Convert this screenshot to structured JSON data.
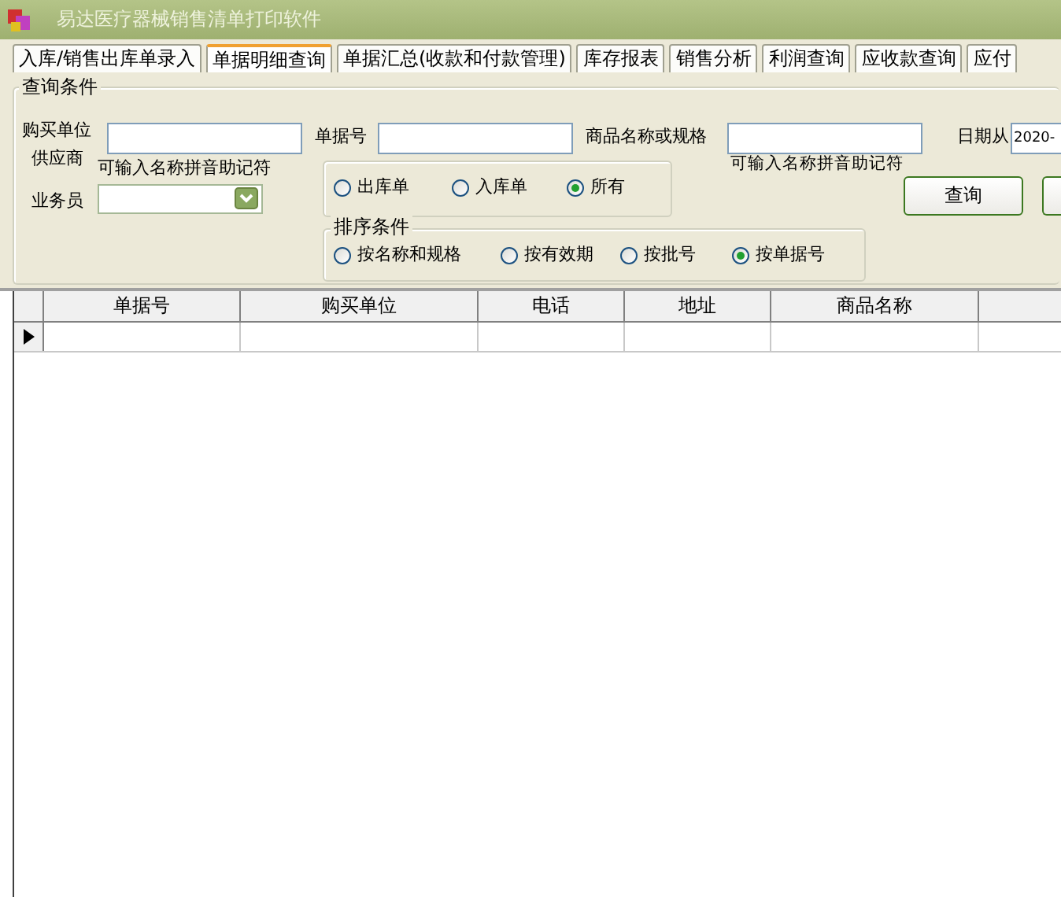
{
  "window": {
    "title": "易达医疗器械销售清单打印软件"
  },
  "tabs": [
    {
      "label": "入库/销售出库单录入",
      "selected": false
    },
    {
      "label": "单据明细查询",
      "selected": true
    },
    {
      "label": "单据汇总(收款和付款管理)",
      "selected": false
    },
    {
      "label": "库存报表",
      "selected": false
    },
    {
      "label": "销售分析",
      "selected": false
    },
    {
      "label": "利润查询",
      "selected": false
    },
    {
      "label": "应收款查询",
      "selected": false
    },
    {
      "label": "应付",
      "selected": false
    }
  ],
  "query": {
    "title": "查询条件",
    "buyer_label": "购买单位",
    "supplier_label": "供应商",
    "buyer_hint": "可输入名称拼音助记符",
    "salesperson_label": "业务员",
    "doc_no_label": "单据号",
    "product_label": "商品名称或规格",
    "product_hint": "可输入名称拼音助记符",
    "date_label": "日期从",
    "date_value": "2020-",
    "doc_types": [
      {
        "label": "出库单",
        "selected": false
      },
      {
        "label": "入库单",
        "selected": false
      },
      {
        "label": "所有",
        "selected": true
      }
    ],
    "sort_title": "排序条件",
    "sort_options": [
      {
        "label": "按名称和规格",
        "selected": false
      },
      {
        "label": "按有效期",
        "selected": false
      },
      {
        "label": "按批号",
        "selected": false
      },
      {
        "label": "按单据号",
        "selected": true
      }
    ],
    "search_button": "查询"
  },
  "table": {
    "columns": [
      "单据号",
      "购买单位",
      "电话",
      "地址",
      "商品名称"
    ],
    "rows": [
      {
        "current": true
      }
    ]
  }
}
